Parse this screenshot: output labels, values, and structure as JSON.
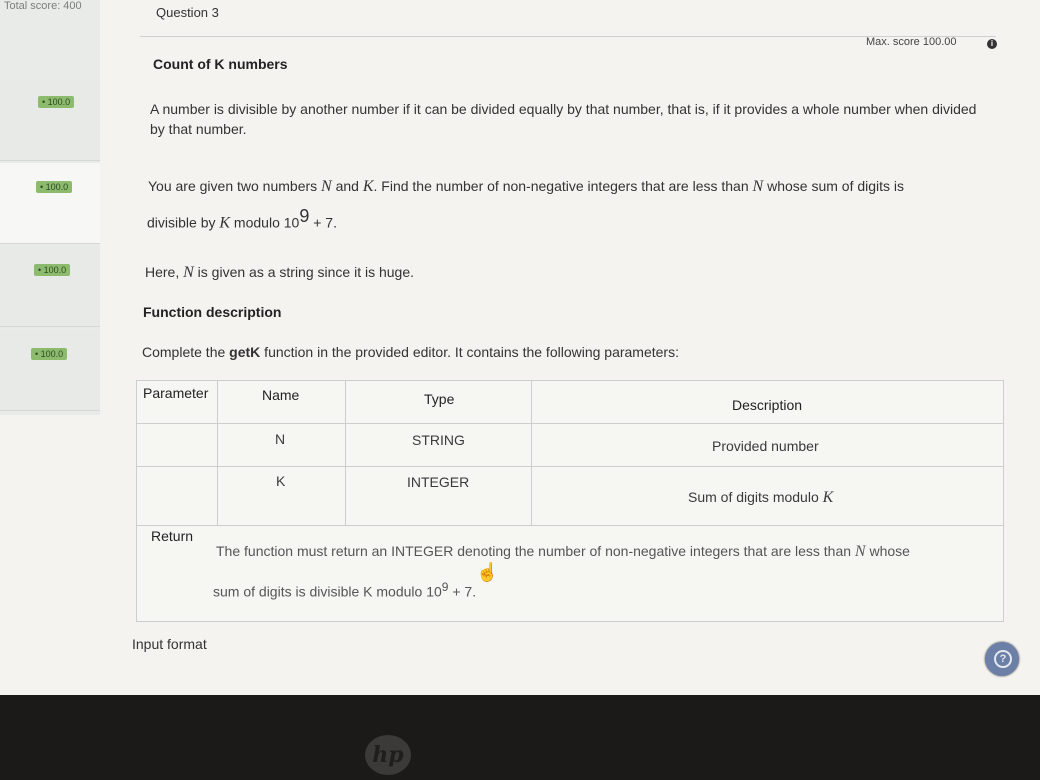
{
  "sidebar": {
    "total_score": "Total score: 400",
    "questions": [
      {
        "badge": "• 100.0"
      },
      {
        "badge": "• 100.0"
      },
      {
        "badge": "• 100.0"
      },
      {
        "badge": "• 100.0"
      }
    ]
  },
  "header": {
    "question_label": "Question 3",
    "max_score": "Max. score 100.00"
  },
  "problem": {
    "title": "Count of K numbers",
    "p1": "A number is divisible by another number if it can be divided equally by that number, that is, if it provides a whole number when divided by that number.",
    "p2_a": "You are given two numbers ",
    "p2_N": "N",
    "p2_b": " and ",
    "p2_K": "K",
    "p2_c": ". Find the number of non-negative integers that are less than ",
    "p2_N2": "N",
    "p2_d": " whose sum of digits is",
    "p2_line2": "divisible by ",
    "p2_K2": "K",
    "p2_mod": " modulo 10",
    "p2_exp": "9",
    "p2_plus": " + 7.",
    "p3_a": "Here, ",
    "p3_N": "N",
    "p3_b": " is given as a string since it is huge.",
    "func_heading": "Function description",
    "p4_a": "Complete the ",
    "p4_fn": "getK",
    "p4_b": " function in the provided editor. It contains the following parameters:"
  },
  "table": {
    "headers": {
      "parameter": "Parameter",
      "name": "Name",
      "type": "Type",
      "description": "Description"
    },
    "rows": [
      {
        "name": "N",
        "type": "STRING",
        "description": "Provided number"
      },
      {
        "name": "K",
        "type": "INTEGER",
        "description": "Sum of digits modulo ",
        "desc_var": "K"
      }
    ],
    "return_label": "Return",
    "return_a": "The function must return an INTEGER denoting the number of non-negative integers that are less than ",
    "return_N": "N",
    "return_b": " whose",
    "return_line2": "sum of digits is divisible K modulo 10",
    "return_exp": "9",
    "return_plus": " + 7."
  },
  "footer": {
    "input_format": "Input format",
    "help_icon": "?"
  },
  "laptop": {
    "logo": "hp"
  }
}
